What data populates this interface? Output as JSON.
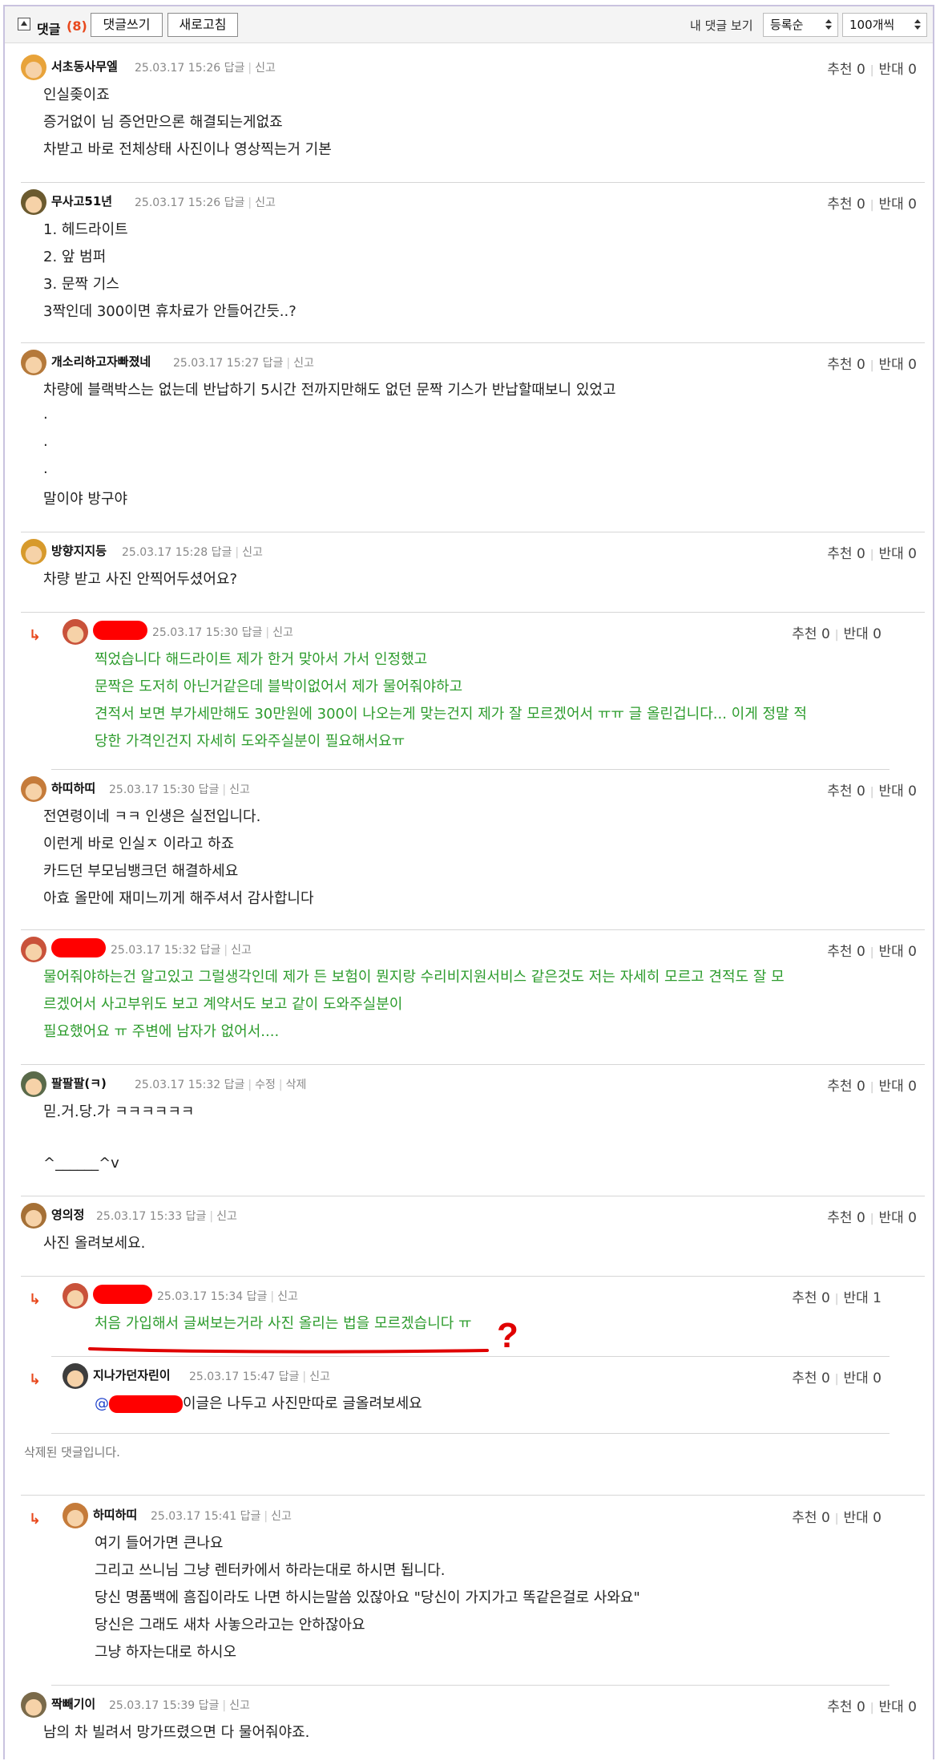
{
  "header": {
    "title": "댓글",
    "count": "(8)",
    "write_button": "댓글쓰기",
    "refresh_button": "새로고침",
    "my_comments": "내 댓글 보기",
    "sort_value": "등록순",
    "page_size_value": "100개씩"
  },
  "labels": {
    "reply": "답글",
    "report": "신고",
    "edit": "수정",
    "delete": "삭제",
    "recommend": "추천",
    "oppose": "반대",
    "deleted_comment": "삭제된 댓글입니다."
  },
  "comments": [
    {
      "nick": "서초동사무엘",
      "time": "25.03.17 15:26",
      "rec": "0",
      "opp": "0",
      "lines": [
        "인실좆이죠",
        "증거없이 님 증언만으론 해결되는게없죠",
        "차받고 바로 전체상태 사진이나 영상찍는거 기본"
      ]
    },
    {
      "nick": "무사고51년",
      "time": "25.03.17 15:26",
      "rec": "0",
      "opp": "0",
      "lines": [
        "1. 헤드라이트",
        "2. 앞 범퍼",
        "3. 문짝 기스",
        "3짝인데 300이면 휴차료가 안들어간듯..?"
      ]
    },
    {
      "nick": "개소리하고자빠졌네",
      "time": "25.03.17 15:27",
      "rec": "0",
      "opp": "0",
      "lines": [
        "차량에 블랙박스는 없는데 반납하기 5시간 전까지만해도 없던 문짝 기스가 반납할때보니 있었고",
        ".",
        ".",
        ".",
        "말이야 방구야"
      ]
    },
    {
      "nick": "방향지지등",
      "time": "25.03.17 15:28",
      "rec": "0",
      "opp": "0",
      "lines": [
        "차량 받고 사진 안찍어두셨어요?"
      ]
    },
    {
      "nick": "",
      "time": "25.03.17 15:30",
      "rec": "0",
      "opp": "0",
      "lines": [
        "찍었습니다 해드라이트 제가 한거 맞아서 가서 인정했고",
        "문짝은 도저히 아닌거같은데 블박이없어서 제가 물어줘야하고",
        "견적서 보면 부가세만해도 30만원에 300이 나오는게 맞는건지 제가 잘 모르겠어서 ㅠㅠ 글 올린겁니다... 이게 정말 적",
        "당한 가격인건지 자세히 도와주실분이 필요해서요ㅠ"
      ]
    },
    {
      "nick": "하띠하띠",
      "time": "25.03.17 15:30",
      "rec": "0",
      "opp": "0",
      "lines": [
        "전연령이네 ㅋㅋ 인생은 실전입니다.",
        "이런게 바로 인실ㅈ 이라고 하죠",
        "카드던 부모님뱅크던 해결하세요",
        "아효 올만에 재미느끼게 해주셔서 감사합니다"
      ]
    },
    {
      "nick": "",
      "time": "25.03.17 15:32",
      "rec": "0",
      "opp": "0",
      "lines": [
        "물어줘야하는건 알고있고 그럴생각인데 제가 든 보험이 뭔지랑 수리비지원서비스 같은것도 저는 자세히 모르고 견적도 잘 모",
        "르겠어서 사고부위도 보고 계약서도 보고 같이 도와주실분이",
        "필요했어요 ㅠ 주변에 남자가 없어서...."
      ]
    },
    {
      "nick": "팔팔팔(ㅋ)",
      "time": "25.03.17 15:32",
      "rec": "0",
      "opp": "0",
      "lines": [
        "믿.거.당.가 ㅋㅋㅋㅋㅋㅋ",
        "",
        "^______^v"
      ]
    },
    {
      "nick": "영의정",
      "time": "25.03.17 15:33",
      "rec": "0",
      "opp": "0",
      "lines": [
        "사진 올려보세요."
      ]
    },
    {
      "nick": "",
      "time": "25.03.17 15:34",
      "rec": "0",
      "opp": "1",
      "lines": [
        "처음 가입해서 글써보는거라 사진 올리는 법을 모르겠습니다 ㅠ"
      ]
    },
    {
      "nick": "지나가던자린이",
      "time": "25.03.17 15:47",
      "rec": "0",
      "opp": "0",
      "lines": [
        "@",
        "이글은 나두고 사진만따로 글올려보세요"
      ]
    },
    {
      "nick": "하띠하띠",
      "time": "25.03.17 15:41",
      "rec": "0",
      "opp": "0",
      "lines": [
        "여기 들어가면 큰나요",
        "그리고 쓰니님 그냥 렌터카에서 하라는대로 하시면 됩니다.",
        "당신 명품백에 흠집이라도 나면 하시는말씀 있잖아요 \"당신이 가지가고 똑같은걸로 사와요\"",
        "당신은 그래도 새차 사놓으라고는 안하잖아요",
        "그냥 하자는대로 하시오"
      ]
    },
    {
      "nick": "짝빼기이",
      "time": "25.03.17 15:39",
      "rec": "0",
      "opp": "0",
      "lines": [
        "남의 차 빌려서 망가뜨렸으면 다 물어줘야죠."
      ]
    }
  ],
  "annotation": {
    "mark": "?"
  },
  "colors": {
    "accent": "#e8491d",
    "green_text": "#2d9c2d",
    "redaction": "#ff0000"
  }
}
